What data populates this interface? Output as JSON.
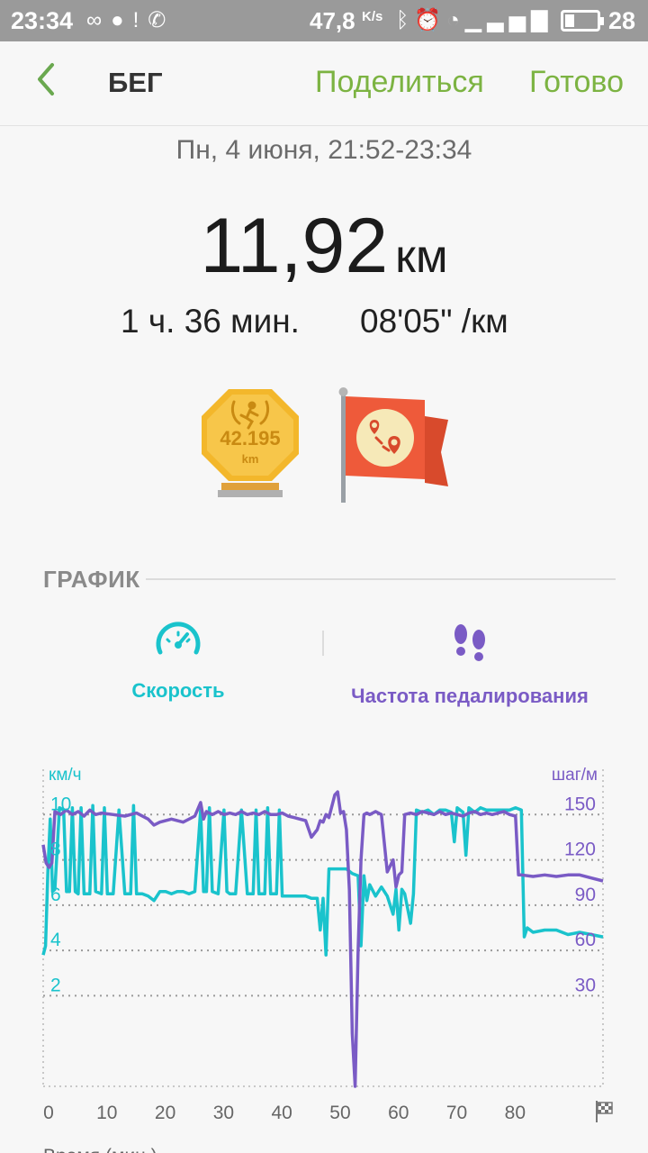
{
  "status_bar": {
    "time": "23:34",
    "left_icons": [
      "infinity-icon",
      "chat-bubble-icon",
      "alert-icon",
      "viber-icon"
    ],
    "network_speed": "47,8",
    "network_speed_unit": "K/s",
    "right_icons": [
      "bluetooth-icon",
      "alarm-icon",
      "wifi-icon",
      "signal-4g-icon"
    ],
    "battery_level": "28"
  },
  "app_bar": {
    "title": "БЕГ",
    "share_label": "Поделиться",
    "done_label": "Готово"
  },
  "workout": {
    "date_range": "Пн, 4 июня, 21:52-23:34",
    "distance": "11,92",
    "distance_unit": "км",
    "duration": "1 ч. 36 мин.",
    "pace": "08'05\" /км"
  },
  "badges": {
    "marathon_value": "42.195",
    "marathon_unit": "km"
  },
  "section": {
    "title": "ГРАФИК"
  },
  "tabs": {
    "speed_label": "Скорость",
    "cadence_label": "Частота педалирования"
  },
  "colors": {
    "accent_green": "#7cb342",
    "speed": "#1ac3cc",
    "cadence": "#7a5bc5",
    "statusbar": "#9a9a9a"
  },
  "chart_data": {
    "type": "line",
    "ylabel_left": "км/ч",
    "ylabel_right": "шаг/м",
    "xlabel": "Время (мин.)",
    "x_ticks": [
      0,
      10,
      20,
      30,
      40,
      50,
      60,
      70,
      80
    ],
    "y_left_ticks": [
      2,
      4,
      6,
      8,
      10
    ],
    "y_right_ticks": [
      30,
      60,
      90,
      120,
      150
    ],
    "ylim_left": [
      -2,
      12
    ],
    "ylim_right": [
      -30,
      180
    ],
    "xlim": [
      0,
      96
    ],
    "grid": true,
    "series": [
      {
        "name": "Скорость",
        "axis": "left",
        "x": [
          0,
          0.4,
          0.8,
          1.2,
          1.6,
          2,
          2.8,
          3.5,
          4,
          4.5,
          5,
          5.5,
          6,
          6.5,
          7,
          8,
          8.5,
          9,
          10,
          10.5,
          11,
          12,
          13,
          14,
          15,
          15.5,
          16,
          17,
          18,
          19,
          20,
          21,
          22,
          23,
          24,
          25,
          26,
          27,
          27.5,
          28,
          28.5,
          29,
          30,
          31,
          31.5,
          32,
          33,
          34,
          35,
          36,
          36.5,
          37,
          38,
          38.5,
          39,
          40,
          40.5,
          41,
          42,
          43,
          44,
          45,
          46,
          47,
          47.5,
          48,
          48.5,
          49,
          50,
          51,
          52,
          53,
          54,
          54.5,
          55,
          55.5,
          56,
          57,
          58,
          59,
          60,
          60.5,
          61,
          61.5,
          62,
          63,
          63.5,
          64,
          65,
          66,
          67,
          68,
          69,
          70,
          70.5,
          71,
          72,
          72.5,
          73,
          74,
          75,
          76,
          77,
          78,
          79,
          80,
          81,
          82,
          82.5,
          83,
          84,
          86,
          88,
          90,
          92,
          94,
          96
        ],
        "y": [
          3.8,
          4.2,
          7.5,
          9.8,
          6.6,
          6.7,
          10.3,
          10.2,
          6.6,
          6.6,
          10.3,
          6.6,
          6.5,
          10.3,
          6.5,
          6.5,
          10.4,
          6.6,
          6.5,
          10.3,
          6.5,
          6.5,
          10.2,
          6.5,
          6.5,
          10.4,
          6.5,
          6.5,
          6.4,
          6.2,
          6.6,
          6.6,
          6.5,
          6.6,
          6.6,
          6.5,
          6.6,
          10.2,
          6.6,
          6.6,
          10.3,
          6.6,
          6.5,
          10.2,
          6.6,
          6.5,
          6.5,
          10.2,
          6.5,
          6.5,
          10.2,
          6.5,
          6.5,
          10.3,
          6.5,
          6.5,
          10.2,
          6.4,
          6.4,
          6.4,
          6.4,
          6.4,
          6.3,
          6.3,
          4.9,
          6.3,
          3.8,
          7.6,
          7.6,
          7.6,
          7.6,
          7.4,
          7.3,
          4.2,
          7.3,
          6.2,
          6.9,
          6.4,
          6.8,
          6.4,
          5.6,
          6.7,
          4.9,
          6.7,
          6.5,
          5.2,
          6.5,
          10.2,
          10.1,
          10.2,
          10.0,
          10.2,
          10.2,
          10.1,
          8.8,
          10.3,
          10.1,
          8.2,
          10.3,
          10.1,
          10.3,
          10.2,
          10.2,
          10.2,
          10.2,
          10.2,
          10.3,
          10.2,
          4.6,
          5.0,
          4.8,
          4.9,
          4.9,
          4.7,
          4.8,
          4.7,
          4.6
        ]
      },
      {
        "name": "Частота педалирования",
        "axis": "right",
        "x": [
          0,
          0.5,
          1,
          1.5,
          2,
          3,
          4,
          5,
          6,
          7,
          8,
          9,
          10,
          12,
          14,
          16,
          18,
          19,
          20,
          22,
          24,
          26,
          27,
          27.5,
          28,
          29,
          30,
          31,
          32,
          33,
          34,
          35,
          36,
          37,
          38,
          39,
          40,
          41,
          42,
          43,
          44,
          45,
          46,
          47,
          47.5,
          48,
          48.5,
          49,
          50,
          50.5,
          51,
          51.5,
          52,
          52.5,
          53,
          53.5,
          54,
          54.5,
          55,
          55.5,
          56,
          57,
          58,
          59,
          60,
          60.5,
          61,
          61.5,
          62,
          63,
          64,
          65,
          66,
          67,
          68,
          69,
          70,
          71,
          72,
          73,
          74,
          75,
          76,
          77,
          78,
          79,
          80,
          81,
          81.5,
          82,
          84,
          86,
          88,
          90,
          92,
          94,
          96
        ],
        "y": [
          130,
          118,
          115,
          118,
          152,
          150,
          153,
          150,
          152,
          149,
          153,
          150,
          151,
          150,
          149,
          151,
          147,
          143,
          145,
          147,
          145,
          149,
          158,
          147,
          152,
          150,
          152,
          150,
          151,
          150,
          152,
          150,
          151,
          150,
          152,
          150,
          150,
          151,
          149,
          148,
          147,
          146,
          135,
          140,
          146,
          145,
          150,
          148,
          163,
          165,
          151,
          152,
          140,
          100,
          5,
          -30,
          60,
          120,
          150,
          151,
          150,
          152,
          150,
          112,
          120,
          102,
          110,
          112,
          150,
          151,
          150,
          152,
          151,
          150,
          152,
          150,
          151,
          150,
          149,
          151,
          152,
          150,
          151,
          150,
          151,
          152,
          150,
          149,
          110,
          110,
          109,
          110,
          109,
          110,
          110,
          108,
          106
        ]
      }
    ]
  }
}
